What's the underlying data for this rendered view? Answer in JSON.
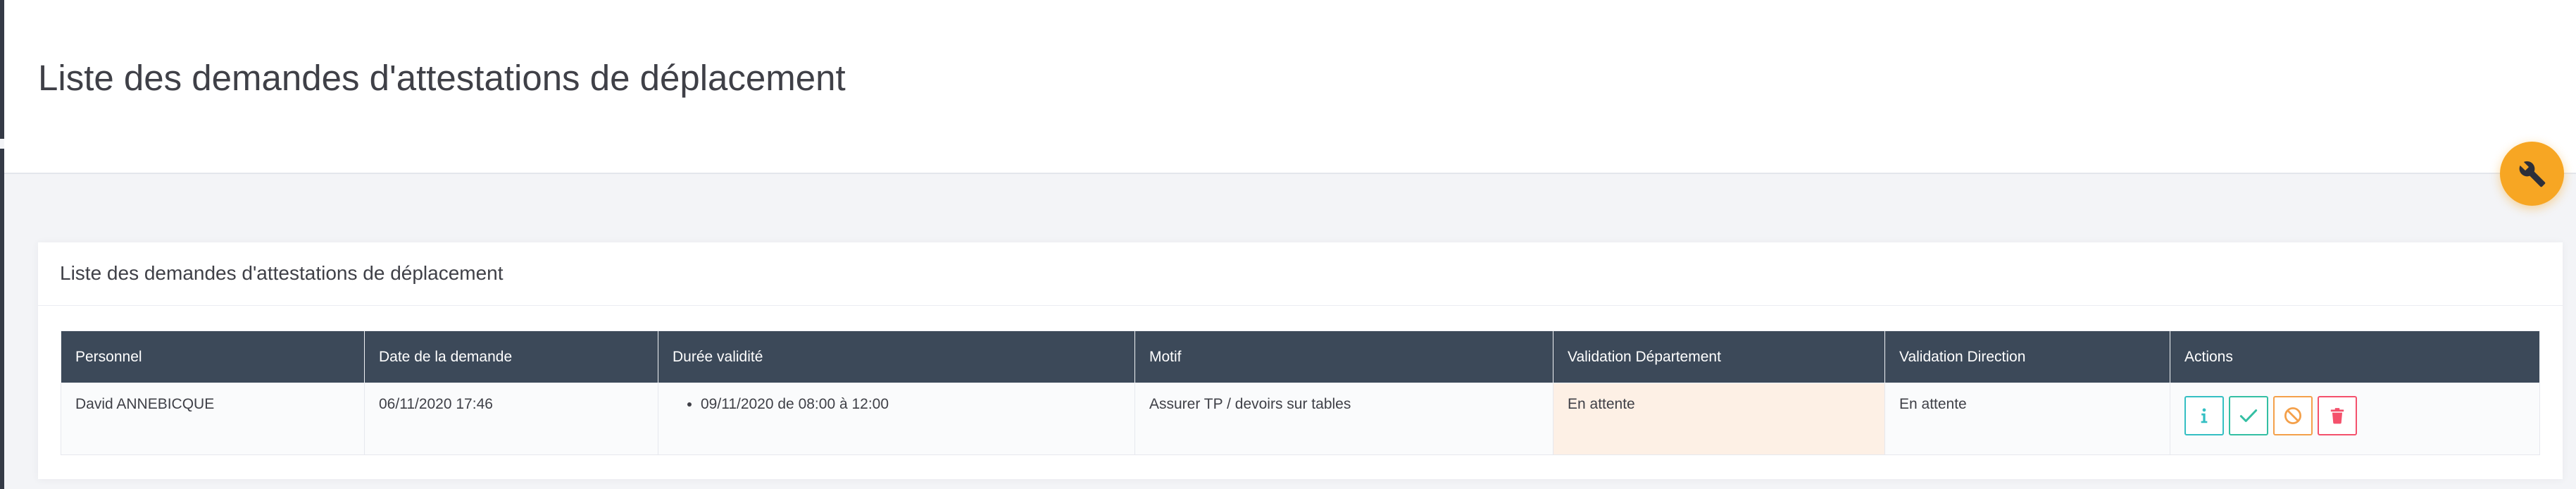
{
  "header": {
    "title": "Liste des demandes d'attestations de déplacement"
  },
  "portlet": {
    "title": "Liste des demandes d'attestations de déplacement"
  },
  "table": {
    "columns": [
      "Personnel",
      "Date de la demande",
      "Durée validité",
      "Motif",
      "Validation Département",
      "Validation Direction",
      "Actions"
    ],
    "rows": [
      {
        "personnel": "David ANNEBICQUE",
        "date": "06/11/2020 17:46",
        "validity": [
          "09/11/2020 de 08:00 à 12:00"
        ],
        "motif": "Assurer TP / devoirs sur tables",
        "validation_departement": "En attente",
        "validation_direction": "En attente",
        "actions": [
          "info-icon",
          "check-icon",
          "ban-icon",
          "trash-icon"
        ]
      }
    ]
  },
  "colors": {
    "header_bg": "#3c4959",
    "pending_bg": "#fdf0e5",
    "accent_orange": "#f7a623",
    "info": "#34bfc3",
    "success": "#34bfa3",
    "warning": "#f4a04a",
    "danger": "#f4516c"
  },
  "icons": {
    "tools_button": "wrench-icon"
  }
}
